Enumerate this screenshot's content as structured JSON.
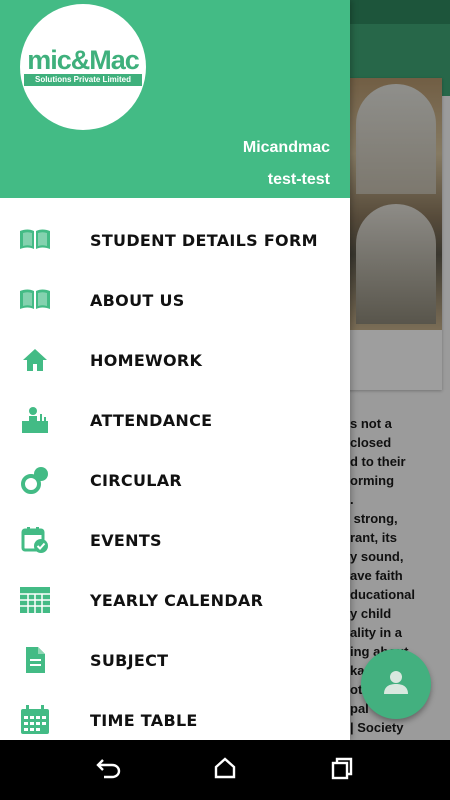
{
  "header": {
    "logo_text": "mic&Mac",
    "logo_subtitle": "Solutions Private Limited",
    "user_name": "Micandmac",
    "user_sub": "test-test"
  },
  "menu": {
    "items": [
      {
        "label": "STUDENT DETAILS FORM",
        "icon": "book-icon"
      },
      {
        "label": "ABOUT US",
        "icon": "book-icon"
      },
      {
        "label": "HOMEWORK",
        "icon": "home-icon"
      },
      {
        "label": "ATTENDANCE",
        "icon": "attendance-desk-icon"
      },
      {
        "label": "CIRCULAR",
        "icon": "circular-icon"
      },
      {
        "label": "EVENTS",
        "icon": "event-calendar-icon"
      },
      {
        "label": "YEARLY CALENDAR",
        "icon": "grid-calendar-icon"
      },
      {
        "label": "SUBJECT",
        "icon": "document-icon"
      },
      {
        "label": "TIME TABLE",
        "icon": "timetable-calendar-icon"
      }
    ]
  },
  "background": {
    "text": "s not a\nclosed\nd to their\norming\n.\n strong,\nrant, its\ny sound,\nave faith\nducational\ny child\nality in a\ning about\nkar\not\npal\n| Society\n  ainian"
  },
  "colors": {
    "accent": "#43bb85",
    "appbar": "#3fa776",
    "fab": "#43b07f"
  }
}
